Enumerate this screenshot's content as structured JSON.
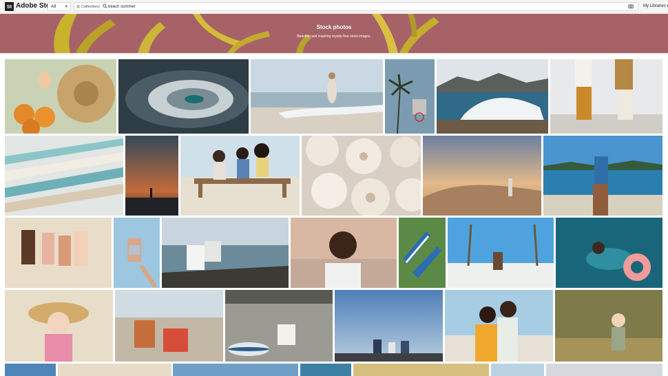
{
  "brand": {
    "mark": "St",
    "name": "Adobe Stock"
  },
  "header": {
    "filter_value": "All",
    "collections_label": "Collections",
    "search_value": "beach summer",
    "libraries_label": "My Libraries"
  },
  "hero": {
    "title": "Stock photos",
    "subtitle": "Beautiful and inspiring royalty-free stock images."
  },
  "colors": {
    "hero_bg": "#a66267",
    "topbar_bg": "#f5f5f5"
  },
  "results": [
    "oranges and straw hat",
    "ocean whirlpool",
    "woman running on beach",
    "palm tree and basketball hoop",
    "surfer on wave",
    "couple walking barefoot",
    "striped surfboards",
    "silhouette at sunset",
    "friends on bench",
    "seashells",
    "man walking dunes",
    "woman with scarf by sea",
    "children on beach",
    "girl jumping",
    "couple on hammock net",
    "boy portrait at sunset",
    "striped deck chairs",
    "palm trees beach",
    "woman with float ring",
    "girl in sun hat",
    "kids with backpack on pebbles",
    "man sitting by paddle board",
    "family on pier",
    "couple embracing",
    "toddler in field",
    "row 5 image 1",
    "row 5 image 2",
    "row 5 image 3",
    "row 5 image 4",
    "row 5 image 5",
    "row 5 image 6",
    "row 5 image 7"
  ]
}
